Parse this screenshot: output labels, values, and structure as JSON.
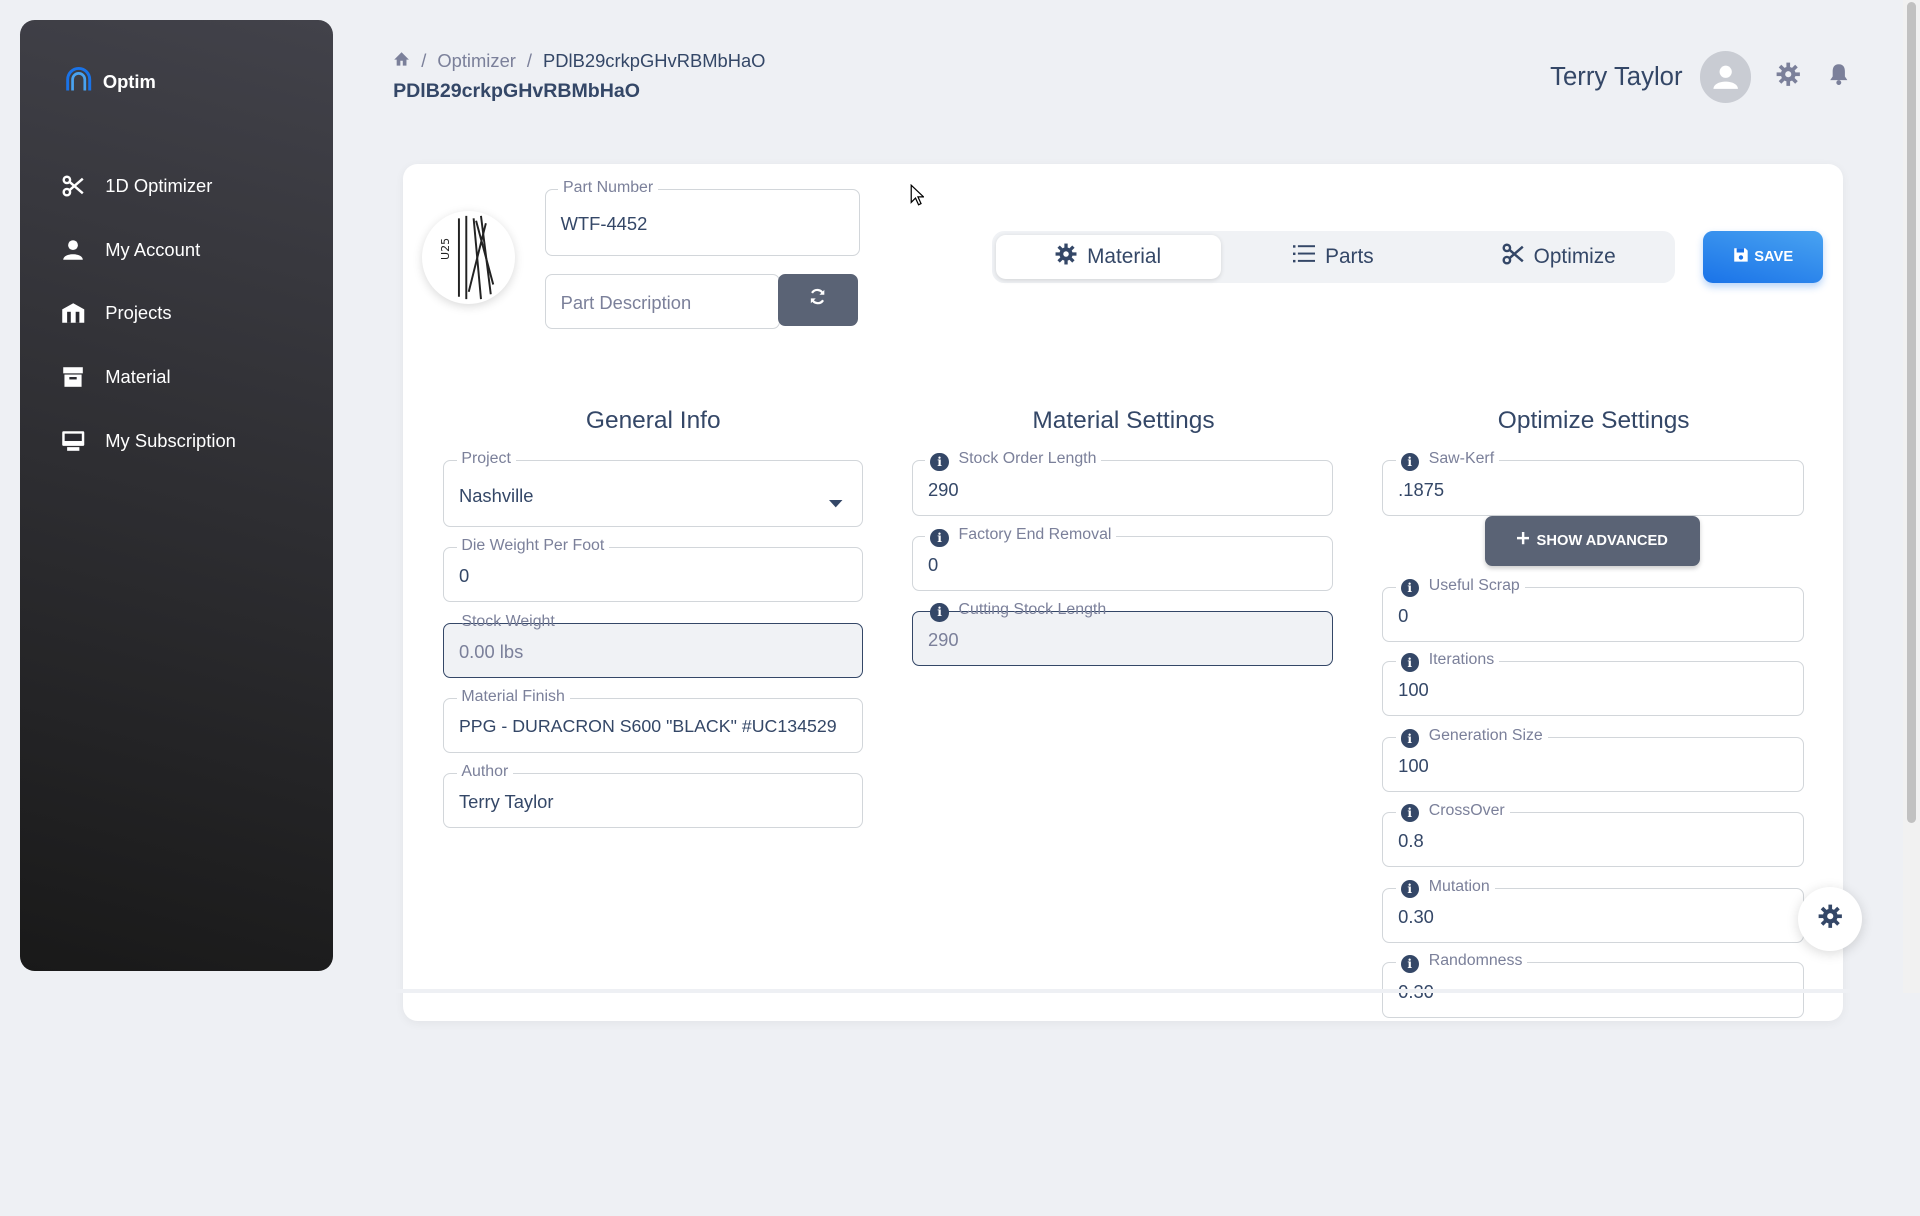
{
  "brand": {
    "name": "Optim"
  },
  "sidebar": {
    "items": [
      {
        "label": "1D Optimizer",
        "icon": "scissors-icon"
      },
      {
        "label": "My Account",
        "icon": "person-icon"
      },
      {
        "label": "Projects",
        "icon": "warehouse-icon"
      },
      {
        "label": "Material",
        "icon": "archive-icon"
      },
      {
        "label": "My Subscription",
        "icon": "monitor-icon"
      }
    ]
  },
  "breadcrumb": {
    "parent": "Optimizer",
    "current": "PDlB29crkpGHvRBMbHaO"
  },
  "page_title": "PDlB29crkpGHvRBMbHaO",
  "user": {
    "name": "Terry Taylor"
  },
  "part": {
    "number_label": "Part Number",
    "number_value": "WTF-4452",
    "description_placeholder": "Part Description"
  },
  "tabs": [
    {
      "label": "Material",
      "icon": "gear-icon",
      "active": true
    },
    {
      "label": "Parts",
      "icon": "list-icon",
      "active": false
    },
    {
      "label": "Optimize",
      "icon": "scissors-icon",
      "active": false
    }
  ],
  "save_label": "SAVE",
  "general_info": {
    "title": "General Info",
    "project_label": "Project",
    "project_value": "Nashville",
    "die_weight_label": "Die Weight Per Foot",
    "die_weight_value": "0",
    "stock_weight_label": "Stock Weight",
    "stock_weight_value": "0.00 lbs",
    "finish_label": "Material Finish",
    "finish_value": "PPG - DURACRON S600 \"BLACK\" #UC134529",
    "author_label": "Author",
    "author_value": "Terry Taylor"
  },
  "material_settings": {
    "title": "Material Settings",
    "stock_order_label": "Stock Order Length",
    "stock_order_value": "290",
    "factory_end_label": "Factory End Removal",
    "factory_end_value": "0",
    "cutting_stock_label": "Cutting Stock Length",
    "cutting_stock_value": "290"
  },
  "optimize_settings": {
    "title": "Optimize Settings",
    "saw_kerf_label": "Saw-Kerf",
    "saw_kerf_value": ".1875",
    "show_advanced_label": "SHOW ADVANCED",
    "useful_scrap_label": "Useful Scrap",
    "useful_scrap_value": "0",
    "iterations_label": "Iterations",
    "iterations_value": "100",
    "generation_size_label": "Generation Size",
    "generation_size_value": "100",
    "crossover_label": "CrossOver",
    "crossover_value": "0.8",
    "mutation_label": "Mutation",
    "mutation_value": "0.30",
    "randomness_label": "Randomness",
    "randomness_value": "0.30"
  },
  "colors": {
    "primary": "#1A73E8",
    "dark": "#344767",
    "sidebar": "#191919"
  }
}
